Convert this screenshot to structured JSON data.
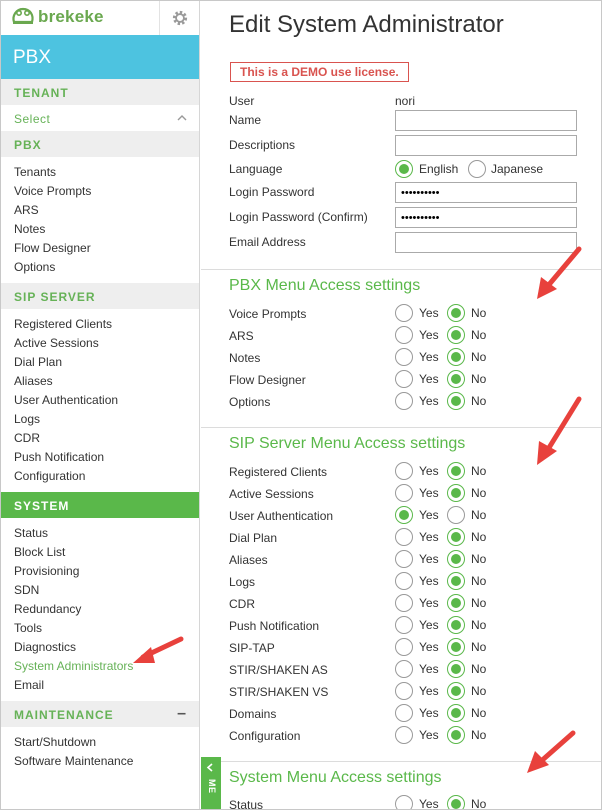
{
  "app": {
    "logo": "brekeke",
    "banner": "PBX"
  },
  "sidebar": {
    "tenant": {
      "heading": "TENANT",
      "select": "Select"
    },
    "pbx": {
      "heading": "PBX",
      "items": [
        "Tenants",
        "Voice Prompts",
        "ARS",
        "Notes",
        "Flow Designer",
        "Options"
      ]
    },
    "sip": {
      "heading": "SIP SERVER",
      "items": [
        "Registered Clients",
        "Active Sessions",
        "Dial Plan",
        "Aliases",
        "User Authentication",
        "Logs",
        "CDR",
        "Push Notification",
        "Configuration"
      ]
    },
    "system": {
      "heading": "SYSTEM",
      "items": [
        "Status",
        "Block List",
        "Provisioning",
        "SDN",
        "Redundancy",
        "Tools",
        "Diagnostics",
        "System Administrators",
        "Email"
      ]
    },
    "maintenance": {
      "heading": "MAINTENANCE",
      "toggle": "–",
      "items": [
        "Start/Shutdown",
        "Software Maintenance"
      ]
    }
  },
  "main": {
    "title": "Edit System Administrator",
    "demo_notice": "This is a DEMO use license.",
    "form": {
      "user_label": "User",
      "user_value": "nori",
      "name_label": "Name",
      "name_value": "",
      "desc_label": "Descriptions",
      "desc_value": "",
      "lang_label": "Language",
      "lang_opt1": "English",
      "lang_opt2": "Japanese",
      "pw_label": "Login Password",
      "pw_value": "••••••••••",
      "pw2_label": "Login Password (Confirm)",
      "pw2_value": "••••••••••",
      "email_label": "Email Address",
      "email_value": ""
    },
    "yes": "Yes",
    "no": "No",
    "pbx_section": {
      "title": "PBX Menu Access settings",
      "rows": [
        {
          "label": "Voice Prompts",
          "value": "No"
        },
        {
          "label": "ARS",
          "value": "No"
        },
        {
          "label": "Notes",
          "value": "No"
        },
        {
          "label": "Flow Designer",
          "value": "No"
        },
        {
          "label": "Options",
          "value": "No"
        }
      ]
    },
    "sip_section": {
      "title": "SIP Server Menu Access settings",
      "rows": [
        {
          "label": "Registered Clients",
          "value": "No"
        },
        {
          "label": "Active Sessions",
          "value": "No"
        },
        {
          "label": "User Authentication",
          "value": "Yes"
        },
        {
          "label": "Dial Plan",
          "value": "No"
        },
        {
          "label": "Aliases",
          "value": "No"
        },
        {
          "label": "Logs",
          "value": "No"
        },
        {
          "label": "CDR",
          "value": "No"
        },
        {
          "label": "Push Notification",
          "value": "No"
        },
        {
          "label": "SIP-TAP",
          "value": "No"
        },
        {
          "label": "STIR/SHAKEN AS",
          "value": "No"
        },
        {
          "label": "STIR/SHAKEN VS",
          "value": "No"
        },
        {
          "label": "Domains",
          "value": "No"
        },
        {
          "label": "Configuration",
          "value": "No"
        }
      ]
    },
    "sys_section": {
      "title": "System Menu Access settings",
      "rows": [
        {
          "label": "Status",
          "value": "No"
        }
      ]
    },
    "side_tab": "ME"
  },
  "colors": {
    "accent": "#5ab84a",
    "banner": "#4dc3e0",
    "annotation_arrow": "#e8413c"
  }
}
